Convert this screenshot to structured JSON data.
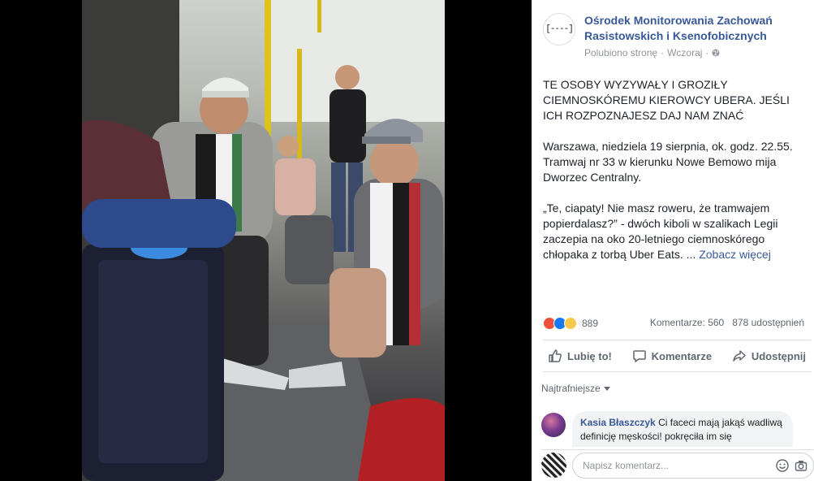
{
  "page": {
    "name": "Ośrodek Monitorowania Zachowań Rasistowskich i Ksenofobicznych",
    "avatar_text": "[----]",
    "liked_label": "Polubiono stronę",
    "separator": "·",
    "time": "Wczoraj"
  },
  "post": {
    "headline": "TE OSOBY WYZYWAŁY I GROZIŁY CIEMNOSKÓREMU KIEROWCY UBERA. JEŚLI ICH ROZPOZNAJESZ DAJ NAM ZNAĆ",
    "paragraph2": "Warszawa, niedziela 19 sierpnia, ok. godz. 22.55. Tramwaj nr 33 w kierunku Nowe Bemowo mija Dworzec Centralny.",
    "paragraph3": "„Te, ciapaty! Nie masz roweru, że tramwajem popierdalasz?” - dwóch kiboli w szalikach Legii zaczepia na oko 20-letniego ciemnoskórego chłopaka z torbą Uber Eats. ...",
    "see_more": "Zobacz więcej"
  },
  "stats": {
    "reactions_count": "889",
    "comments": "Komentarze: 560",
    "shares": "878 udostępnień",
    "reaction_icons": [
      "angry-icon",
      "like-icon",
      "sad-icon"
    ]
  },
  "actions": {
    "like": "Lubię to!",
    "comment": "Komentarze",
    "share": "Udostępnij"
  },
  "comments": {
    "sort_label": "Najtrafniejsze",
    "items": [
      {
        "author": "Kasia Błaszczyk",
        "text": "Ci faceci mają jakąś wadliwą definicję męskości! pokręciła im się"
      }
    ]
  },
  "composer": {
    "placeholder": "Napisz komentarz..."
  },
  "colors": {
    "link": "#385898",
    "text": "#1d2129",
    "muted": "#90949c",
    "divider": "#dadde1",
    "photo_background": "#000000"
  }
}
